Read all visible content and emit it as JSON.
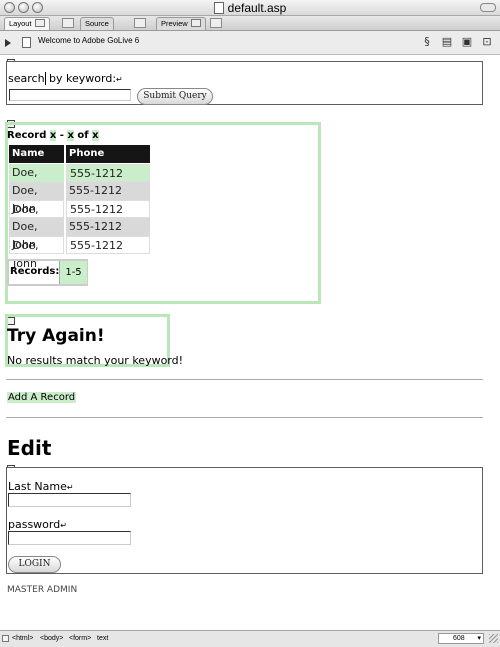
{
  "window": {
    "title": "default.asp"
  },
  "tabs": [
    {
      "label": "Layout"
    },
    {
      "label": "Source"
    },
    {
      "label": "Preview"
    }
  ],
  "toolbar": {
    "page_title": "Welcome to Adobe GoLive 6"
  },
  "search_form": {
    "label_part1": "search",
    "label_part2": " by keyword:",
    "return_glyph": "↵",
    "input_value": "",
    "submit_label": "Submit Query"
  },
  "record_section": {
    "prefix": "Record ",
    "x1": "x",
    "dash": " - ",
    "x2": "x",
    "of": " of ",
    "x3": "x",
    "columns": [
      "Name",
      "Phone Number"
    ],
    "rows": [
      {
        "name": "Doe, John",
        "phone": "555-1212"
      },
      {
        "name": "Doe, John",
        "phone": "555-1212"
      },
      {
        "name": "Doe, John",
        "phone": "555-1212"
      },
      {
        "name": "Doe, John",
        "phone": "555-1212"
      },
      {
        "name": "Doe, John",
        "phone": "555-1212"
      }
    ],
    "records_label": "Records:",
    "records_range": "1-5"
  },
  "try_again": {
    "heading": "Try Again!",
    "message": "No results match your keyword!"
  },
  "add_record_link": "Add A Record",
  "edit": {
    "heading": "Edit",
    "last_name_label": "Last Name",
    "password_label": "password",
    "login_label": "LOGIN"
  },
  "master_admin": "MASTER ADMIN",
  "statusbar": {
    "path": [
      "<html>",
      "<body>",
      "<form>",
      "text"
    ],
    "width_value": "608"
  },
  "colors": {
    "highlight_green": "#b9e7b9",
    "header_black": "#151515"
  }
}
